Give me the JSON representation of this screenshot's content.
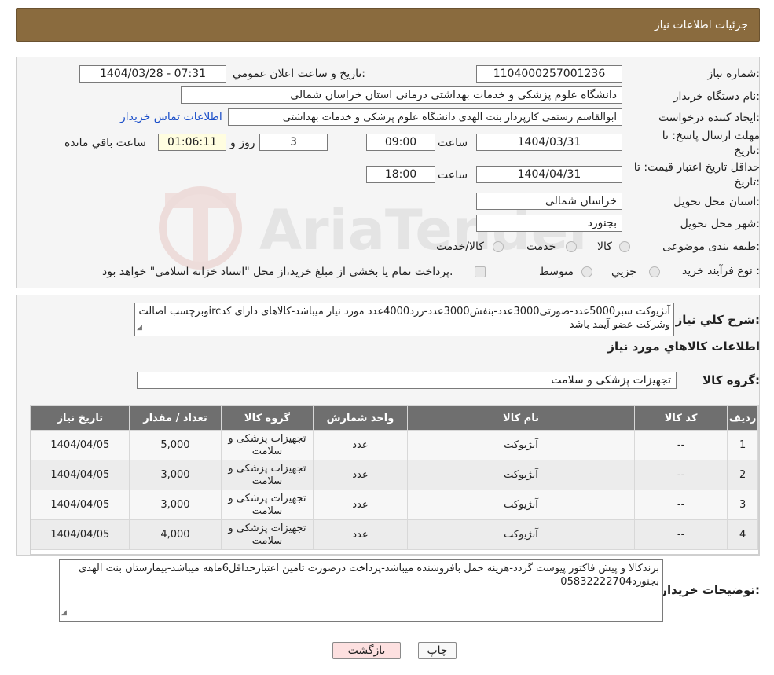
{
  "header": {
    "title": "جزئیات اطلاعات نیاز"
  },
  "form": {
    "need_number_label": "شماره نیاز:",
    "need_number": "1104000257001236",
    "announce_label": "تاریخ و ساعت اعلان عمومي:",
    "announce_value": "1404/03/28 - 07:31",
    "buyer_org_label": "نام دستگاه خريدار:",
    "buyer_org": "دانشگاه علوم پزشکی و خدمات بهداشتی درمانی استان خراسان شمالی",
    "creator_label": "ايجاد کننده درخواست:",
    "creator": "ابوالقاسم رستمی کارپرداز بنت الهدی دانشگاه علوم پزشکی و خدمات بهداشتی",
    "contact_link": "اطلاعات تماس خريدار",
    "deadline_label_1": "مهلت ارسال پاسخ: تا",
    "deadline_label_2": "تاريخ:",
    "deadline_date": "1404/03/31",
    "time_label": "ساعت",
    "deadline_time": "09:00",
    "days_value": "3",
    "days_label": "روز و",
    "remaining_time": "01:06:11",
    "remaining_label": "ساعت باقي مانده",
    "validity_label_1": "حداقل تاريخ اعتبار قيمت: تا",
    "validity_label_2": "تاريخ:",
    "validity_date": "1404/04/31",
    "validity_time": "18:00",
    "province_label": "استان محل تحويل:",
    "province": "خراسان شمالی",
    "city_label": "شهر محل تحويل:",
    "city": "بجنورد",
    "category_label": "طبقه بندی موضوعی:",
    "category_options": [
      "کالا",
      "خدمت",
      "کالا/خدمت"
    ],
    "process_label": "نوع فرآيند خريد :",
    "process_options": [
      "جزيي",
      "متوسط"
    ],
    "process_note": "پرداخت تمام یا بخشی از مبلغ خرید،از محل \"اسناد خزانه اسلامی\" خواهد بود."
  },
  "watermark": {
    "text": "AriaTender.neT"
  },
  "description": {
    "label": "شرح کلي نياز:",
    "text": "آنژیوکت سبز5000عدد-صورتی3000عدد-بنفش3000عدد-زرد4000عدد مورد نیاز میباشد-کالاهای دارای کدircوبرچسب اصالت وشرکت عضو آیمد باشد"
  },
  "goods_section": {
    "title": "اطلاعات کالاهاي مورد نياز",
    "group_label": "گروه کالا:",
    "group_value": "تجهیزات پزشکی و سلامت"
  },
  "table": {
    "headers": [
      "رديف",
      "کد کالا",
      "نام کالا",
      "واحد شمارش",
      "گروه کالا",
      "تعداد / مقدار",
      "تاريخ نياز"
    ],
    "rows": [
      [
        "1",
        "--",
        "آنژیوکت",
        "عدد",
        "تجهیزات پزشکی و سلامت",
        "5,000",
        "1404/04/05"
      ],
      [
        "2",
        "--",
        "آنژیوکت",
        "عدد",
        "تجهیزات پزشکی و سلامت",
        "3,000",
        "1404/04/05"
      ],
      [
        "3",
        "--",
        "آنژیوکت",
        "عدد",
        "تجهیزات پزشکی و سلامت",
        "3,000",
        "1404/04/05"
      ],
      [
        "4",
        "--",
        "آنژیوکت",
        "عدد",
        "تجهیزات پزشکی و سلامت",
        "4,000",
        "1404/04/05"
      ]
    ]
  },
  "buyer_notes": {
    "label": "توضيحات خريدار:",
    "text": "برندکالا و پیش فاکتور پیوست گردد-هزینه حمل بافروشنده میباشد-پرداخت درصورت تامین اعتبارحداقل6ماهه میباشد-بیمارستان بنت الهدی بجنورد05832222704"
  },
  "buttons": {
    "print": "چاپ",
    "back": "بازگشت"
  },
  "colors": {
    "header_bg": "#8a6b3e",
    "table_header_bg": "#6f6f6f",
    "link": "#1a4ec9"
  }
}
